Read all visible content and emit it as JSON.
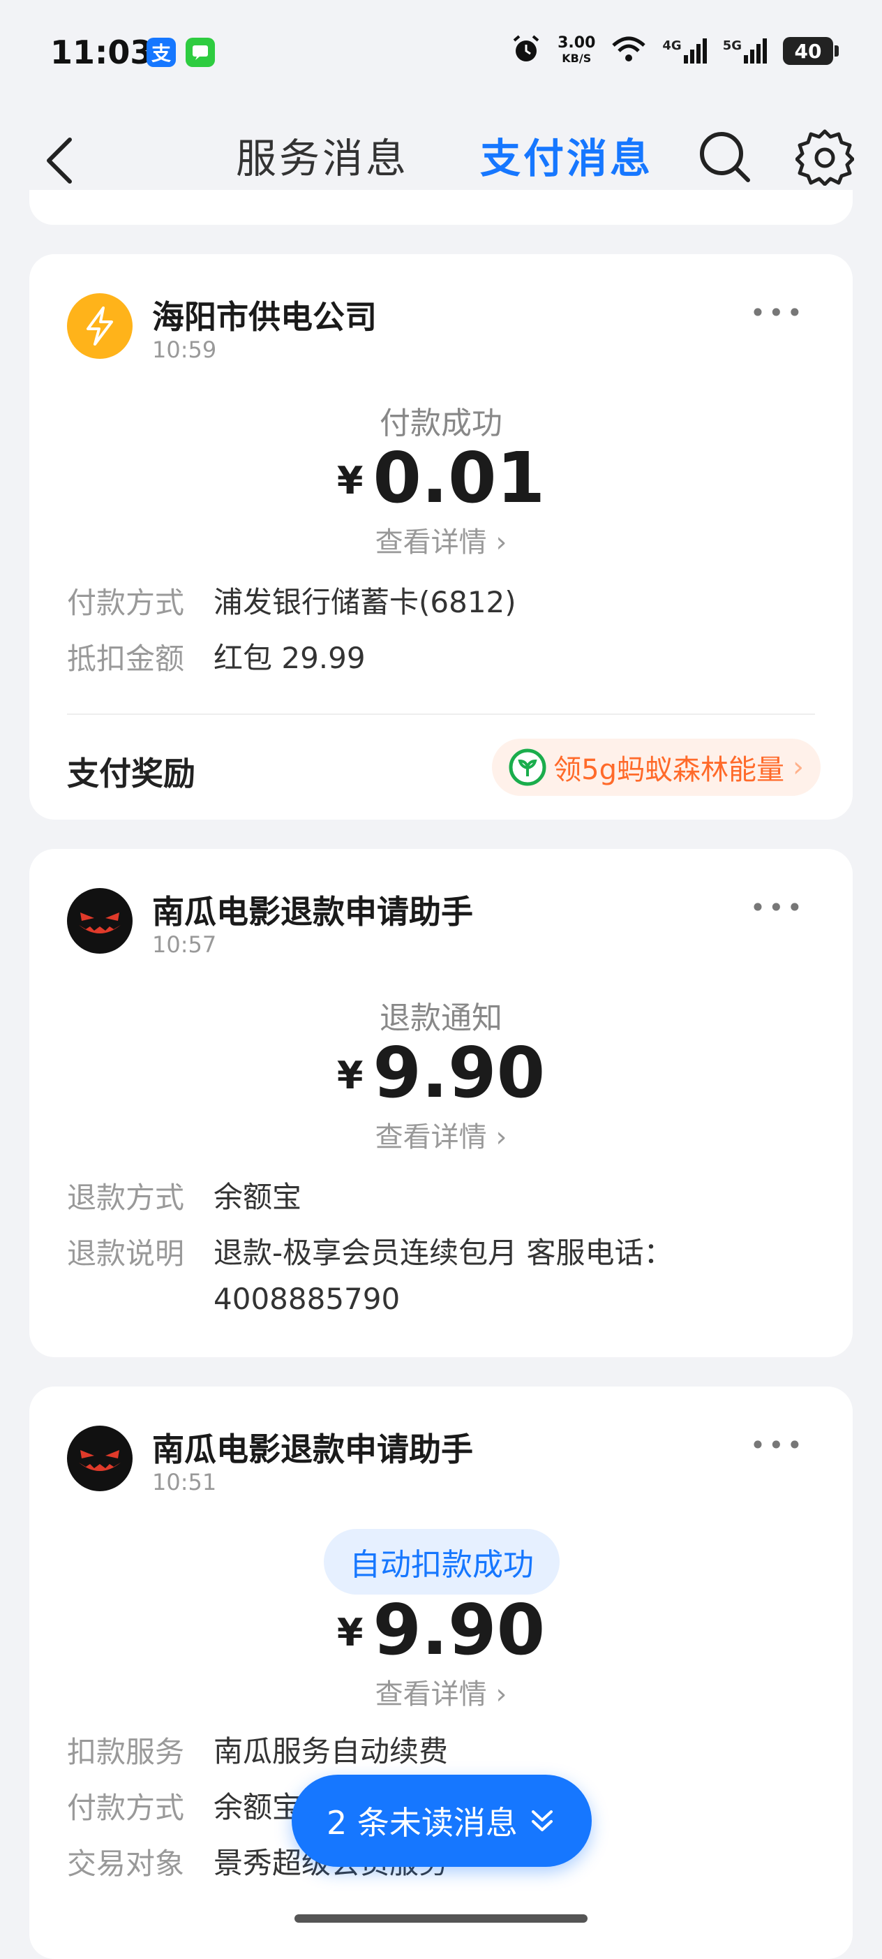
{
  "status_bar": {
    "time": "11:03",
    "app_badges": [
      "支",
      "💬"
    ],
    "net_speed": "3.00",
    "net_unit": "KB/S",
    "signal_4g": "4G",
    "signal_5g": "5G",
    "battery": "40"
  },
  "nav": {
    "tab_service": "服务消息",
    "tab_payment": "支付消息",
    "active_tab": "支付消息",
    "accent": "#1677ff"
  },
  "cards": [
    {
      "sender": "海阳市供电公司",
      "time": "10:59",
      "status": "付款成功",
      "currency": "¥",
      "amount": "0.01",
      "detail_link": "查看详情",
      "fields": [
        {
          "key": "付款方式",
          "value": "浦发银行储蓄卡(6812)"
        },
        {
          "key": "抵扣金额",
          "value": "红包 29.99"
        }
      ],
      "reward_label": "支付奖励",
      "reward_pill": "领5g蚂蚁森林能量"
    },
    {
      "sender": "南瓜电影退款申请助手",
      "time": "10:57",
      "status": "退款通知",
      "currency": "¥",
      "amount": "9.90",
      "detail_link": "查看详情",
      "fields": [
        {
          "key": "退款方式",
          "value": "余额宝"
        },
        {
          "key": "退款说明",
          "value": "退款-极享会员连续包月 客服电话：4008885790"
        }
      ]
    },
    {
      "sender": "南瓜电影退款申请助手",
      "time": "10:51",
      "status": "自动扣款成功",
      "currency": "¥",
      "amount": "9.90",
      "detail_link": "查看详情",
      "fields": [
        {
          "key": "扣款服务",
          "value": "南瓜服务自动续费"
        },
        {
          "key": "付款方式",
          "value": "余额宝"
        },
        {
          "key": "交易对象",
          "value": "景秀超级会员服务"
        }
      ]
    }
  ],
  "unread_button": "2 条未读消息"
}
